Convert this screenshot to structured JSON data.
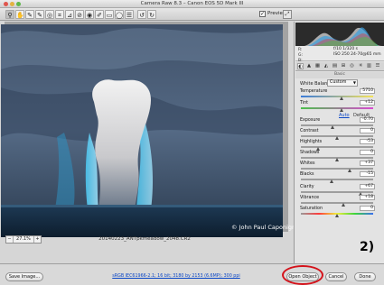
{
  "window": {
    "title": "Camera Raw 8.3  –  Canon EOS 5D Mark III"
  },
  "toolbar": {
    "tools": [
      {
        "name": "zoom-icon",
        "glyph": "⚲"
      },
      {
        "name": "hand-icon",
        "glyph": "✋"
      },
      {
        "name": "white-balance-icon",
        "glyph": "✎"
      },
      {
        "name": "color-sampler-icon",
        "glyph": "✎"
      },
      {
        "name": "targeted-adjust-icon",
        "glyph": "◎"
      },
      {
        "name": "crop-icon",
        "glyph": "⌗"
      },
      {
        "name": "straighten-icon",
        "glyph": "⊿"
      },
      {
        "name": "spot-removal-icon",
        "glyph": "⊘"
      },
      {
        "name": "red-eye-icon",
        "glyph": "◉"
      },
      {
        "name": "adjustment-brush-icon",
        "glyph": "✐"
      },
      {
        "name": "graduated-filter-icon",
        "glyph": "▭"
      },
      {
        "name": "radial-filter-icon",
        "glyph": "◯"
      },
      {
        "name": "preferences-icon",
        "glyph": "☰"
      },
      {
        "name": "rotate-ccw-icon",
        "glyph": "↺"
      },
      {
        "name": "rotate-cw-icon",
        "glyph": "↻"
      }
    ],
    "preview_checked": "✓",
    "preview_label": "Preview",
    "fullscreen_glyph": "⤢"
  },
  "image": {
    "watermark": "© John Paul Caponigro",
    "filename": "20140223_ANTpkmeadow_2048.CR2"
  },
  "zoom": {
    "minus": "−",
    "value": "27.1%",
    "plus": "+"
  },
  "info": {
    "r": "R:",
    "g": "G:",
    "b": "B:",
    "aperture_shutter": "f/10   1/320 s",
    "iso_lens": "ISO 250   24-70@65 mm"
  },
  "panel": {
    "tabs": [
      "◐",
      "▲",
      "▦",
      "◭",
      "▤",
      "⊞",
      "◎",
      "✳",
      "▥",
      "☰"
    ],
    "section_title": "Basic",
    "white_balance_label": "White Balance:",
    "white_balance_value": "Custom",
    "auto_label": "Auto",
    "default_label": "Default",
    "sliders": [
      {
        "label": "Temperature",
        "value": "5710",
        "level": 0.56,
        "track": "temp"
      },
      {
        "label": "Tint",
        "value": "+12",
        "level": 0.56,
        "track": "tint"
      },
      {
        "label": "Exposure",
        "value": "-0.70",
        "level": 0.44,
        "track": "gray"
      },
      {
        "label": "Contrast",
        "value": "0",
        "level": 0.5,
        "track": "gray"
      },
      {
        "label": "Highlights",
        "value": "-53",
        "level": 0.24,
        "track": "gray"
      },
      {
        "label": "Shadows",
        "value": "0",
        "level": 0.5,
        "track": "gray"
      },
      {
        "label": "Whites",
        "value": "+37",
        "level": 0.68,
        "track": "gray"
      },
      {
        "label": "Blacks",
        "value": "-15",
        "level": 0.43,
        "track": "gray"
      },
      {
        "label": "Clarity",
        "value": "+67",
        "level": 0.83,
        "track": "gray"
      },
      {
        "label": "Vibrance",
        "value": "+18",
        "level": 0.59,
        "track": "gray"
      },
      {
        "label": "Saturation",
        "value": "0",
        "level": 0.5,
        "track": "sat"
      }
    ]
  },
  "annotation": {
    "step": "2)"
  },
  "footer": {
    "save_image": "Save Image...",
    "workflow": "sRGB IEC61966-2.1; 16 bit; 3180 by 2153 (6.6MP); 300 ppi",
    "open_object": "Open Object",
    "cancel": "Cancel",
    "done": "Done"
  }
}
